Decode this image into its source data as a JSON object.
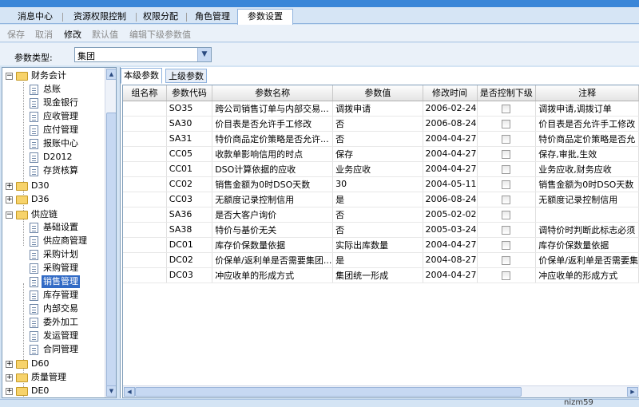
{
  "main_tabs": [
    "消息中心",
    "资源权限控制",
    "权限分配",
    "角色管理",
    "参数设置"
  ],
  "toolbar": {
    "save": "保存",
    "cancel": "取消",
    "edit": "修改",
    "default": "默认值",
    "edit_sub": "编辑下级参数值"
  },
  "filter": {
    "label": "参数类型:",
    "value": "集团"
  },
  "tree": {
    "g1": "财务会计",
    "g1_items": [
      "总账",
      "现金银行",
      "应收管理",
      "应付管理",
      "报账中心",
      "D2012",
      "存货核算"
    ],
    "g2": "D30",
    "g3": "D36",
    "g4": "供应链",
    "g4_items": [
      "基础设置",
      "供应商管理",
      "采购计划",
      "采购管理",
      "销售管理",
      "库存管理",
      "内部交易",
      "委外加工",
      "发运管理",
      "合同管理"
    ],
    "g5": "D60",
    "g6": "质量管理",
    "g7": "DE0"
  },
  "sub_tabs": [
    "本级参数",
    "上级参数"
  ],
  "columns": [
    "组名称",
    "参数代码",
    "参数名称",
    "参数值",
    "修改时间",
    "是否控制下级",
    "注释"
  ],
  "rows": [
    {
      "group": "",
      "code": "SO35",
      "name": "跨公司销售订单与内部交易...",
      "value": "调拨申请",
      "time": "2006-02-24",
      "note": "调拨申请,调拨订单"
    },
    {
      "group": "",
      "code": "SA30",
      "name": "价目表是否允许手工修改",
      "value": "否",
      "time": "2006-08-24",
      "note": "价目表是否允许手工修改"
    },
    {
      "group": "",
      "code": "SA31",
      "name": "特价商品定价策略是否允许...",
      "value": "否",
      "time": "2004-04-27",
      "note": "特价商品定价策略是否允"
    },
    {
      "group": "",
      "code": "CC05",
      "name": "收款单影响信用的时点",
      "value": "保存",
      "time": "2004-04-27",
      "note": "保存,审批,生效"
    },
    {
      "group": "",
      "code": "CC01",
      "name": "DSO计算依据的应收",
      "value": "业务应收",
      "time": "2004-04-27",
      "note": "业务应收,财务应收"
    },
    {
      "group": "",
      "code": "CC02",
      "name": "销售金额为0时DSO天数",
      "value": "30",
      "time": "2004-05-11",
      "note": "销售金额为0时DSO天数"
    },
    {
      "group": "",
      "code": "CC03",
      "name": "无额度记录控制信用",
      "value": "是",
      "time": "2006-08-24",
      "note": "无额度记录控制信用"
    },
    {
      "group": "",
      "code": "SA36",
      "name": "是否大客户询价",
      "value": "否",
      "time": "2005-02-02",
      "note": ""
    },
    {
      "group": "",
      "code": "SA38",
      "name": "特价与基价无关",
      "value": "否",
      "time": "2005-03-24",
      "note": "调特价时判断此标志必须"
    },
    {
      "group": "",
      "code": "DC01",
      "name": "库存价保数量依据",
      "value": "实际出库数量",
      "time": "2004-04-27",
      "note": "库存价保数量依据"
    },
    {
      "group": "",
      "code": "DC02",
      "name": "价保单/返利单是否需要集团...",
      "value": "是",
      "time": "2004-08-27",
      "note": "价保单/返利单是否需要集"
    },
    {
      "group": "",
      "code": "DC03",
      "name": "冲应收单的形成方式",
      "value": "集团统一形成",
      "time": "2004-04-27",
      "note": "冲应收单的形成方式"
    }
  ],
  "status": "nizm59"
}
